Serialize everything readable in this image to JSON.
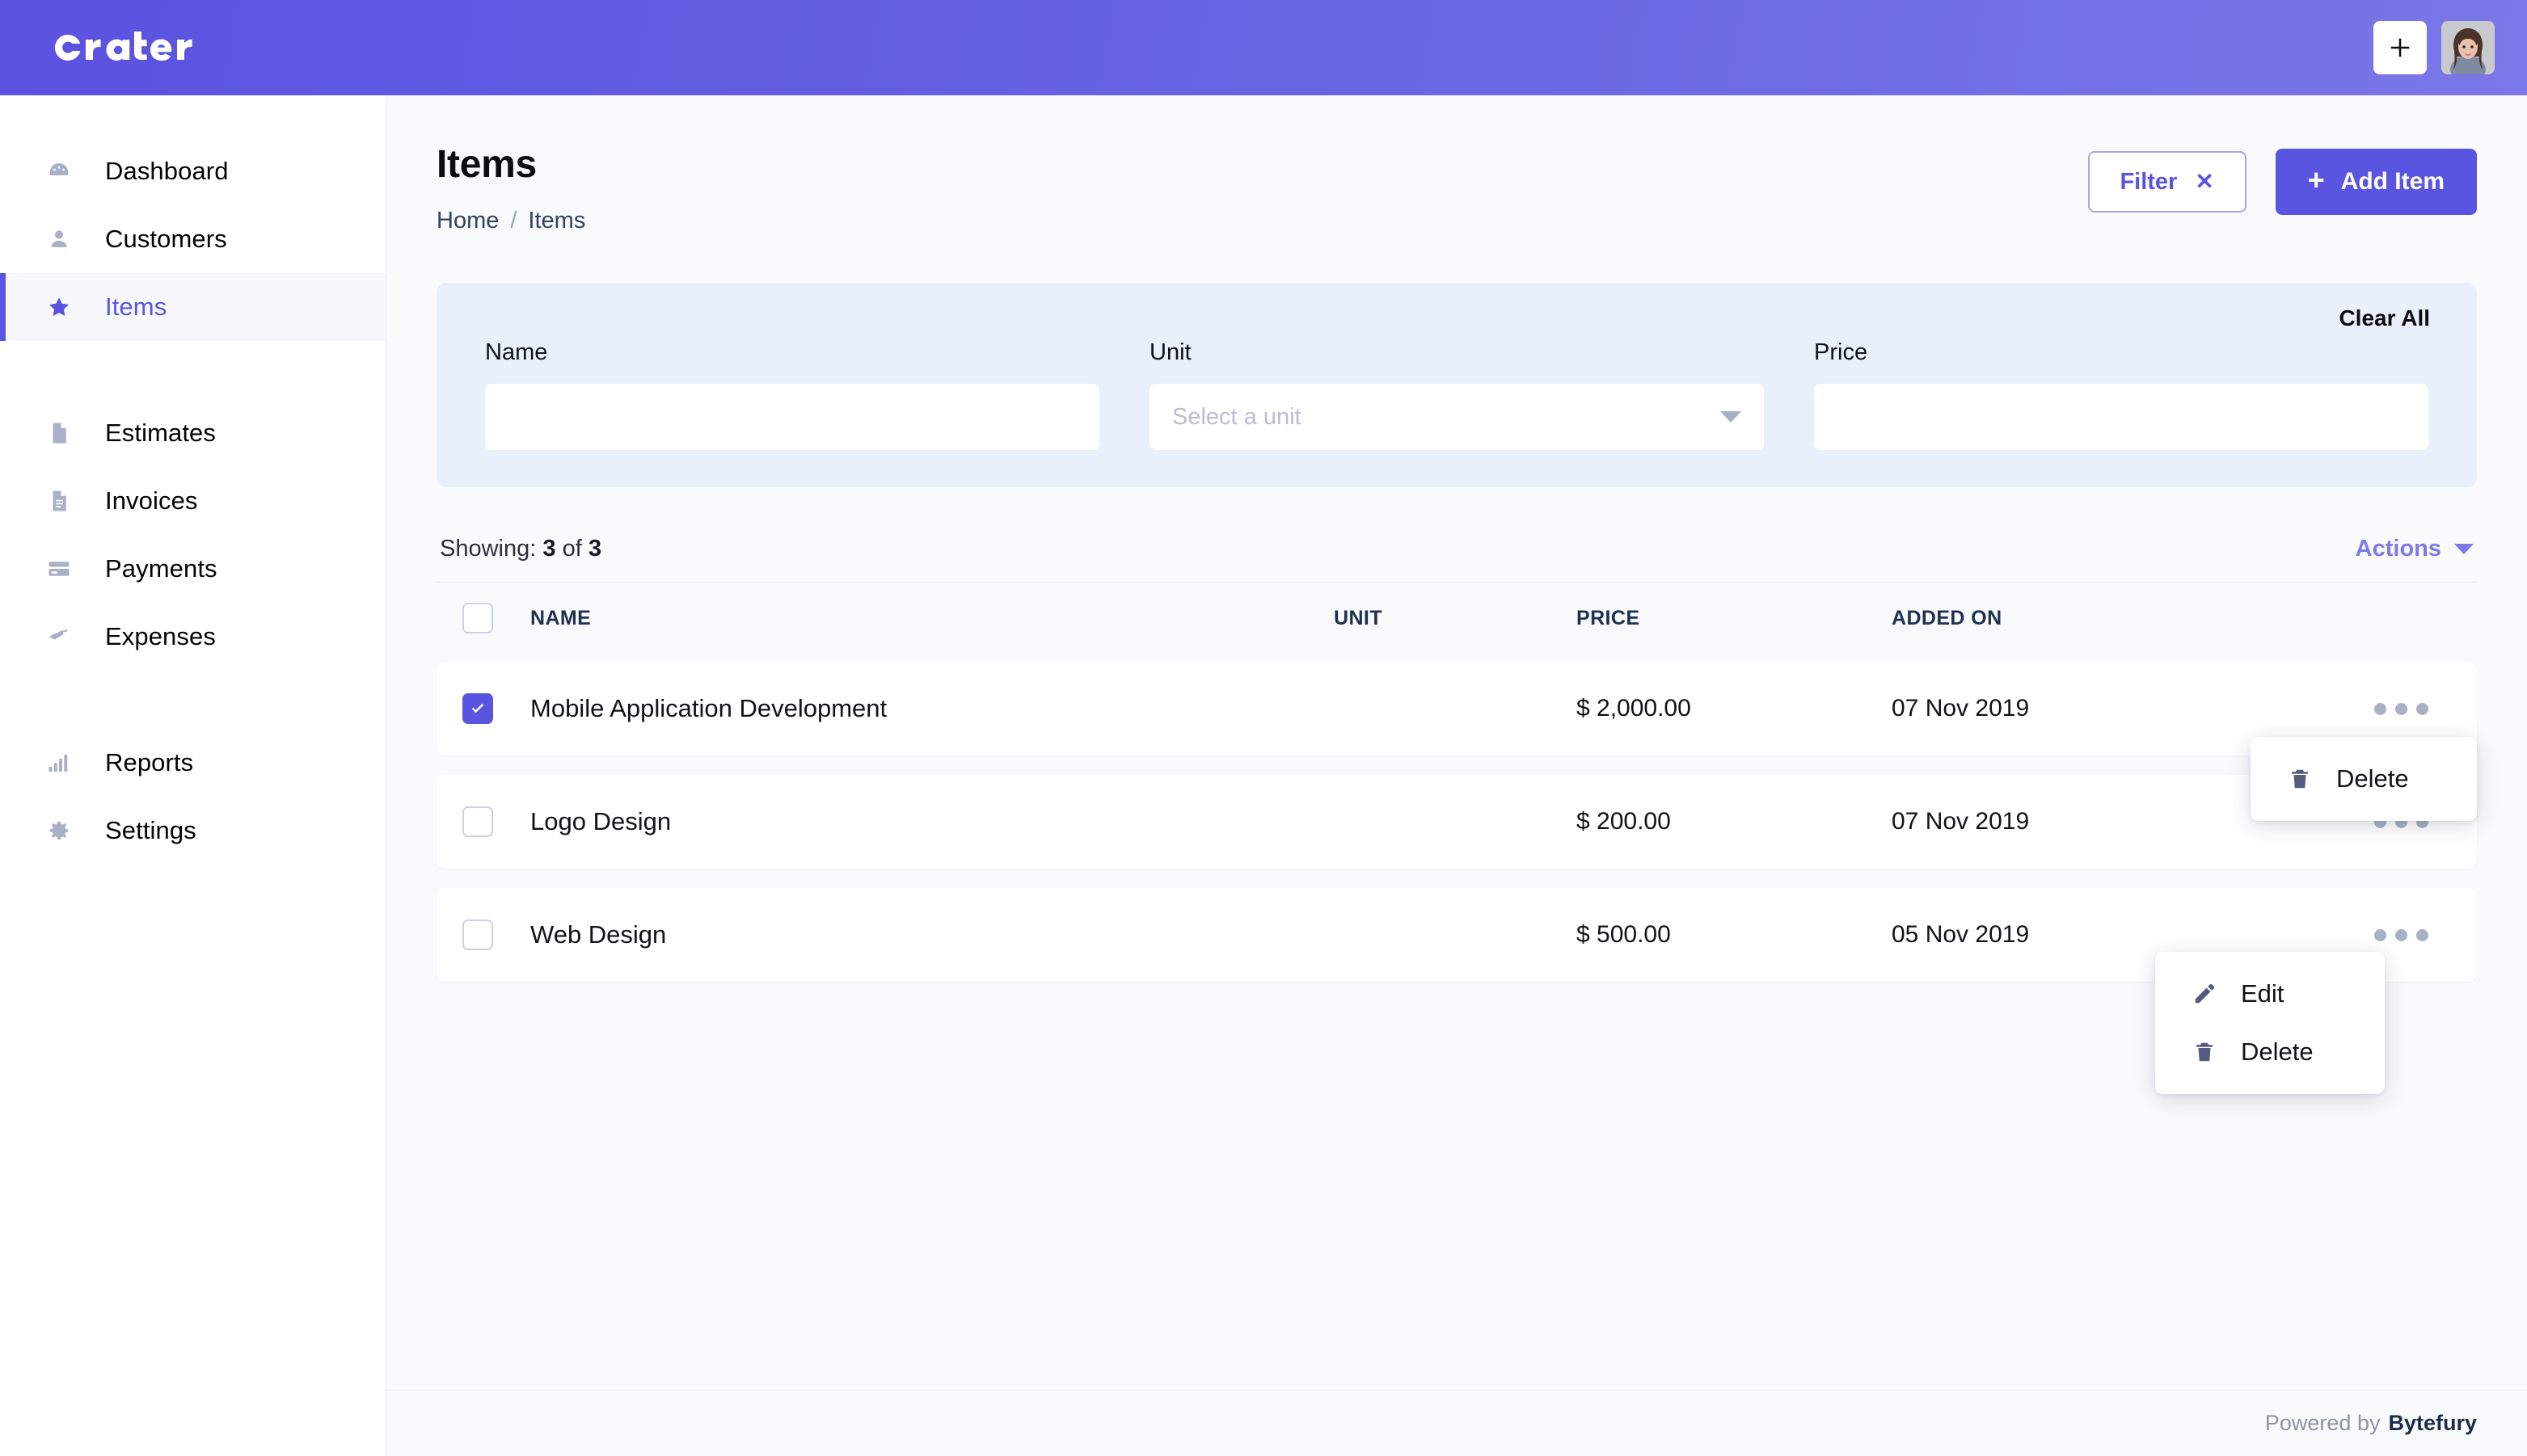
{
  "topbar": {
    "logo_text": "crater",
    "add_button_label": "+",
    "add_button_name": "plus-icon",
    "avatar_label": "user-avatar",
    "brand_color": "#5a55e0"
  },
  "sidebar": {
    "groups": [
      {
        "items": [
          {
            "label": "Dashboard",
            "icon": "dashboard-icon",
            "active": false
          },
          {
            "label": "Customers",
            "icon": "user-icon",
            "active": false
          },
          {
            "label": "Items",
            "icon": "star-icon",
            "active": true
          }
        ]
      },
      {
        "items": [
          {
            "label": "Estimates",
            "icon": "document-icon",
            "active": false
          },
          {
            "label": "Invoices",
            "icon": "invoice-icon",
            "active": false
          },
          {
            "label": "Payments",
            "icon": "credit-card-icon",
            "active": false
          },
          {
            "label": "Expenses",
            "icon": "rocket-icon",
            "active": false
          }
        ]
      },
      {
        "items": [
          {
            "label": "Reports",
            "icon": "bar-chart-icon",
            "active": false
          },
          {
            "label": "Settings",
            "icon": "gear-icon",
            "active": false
          }
        ]
      }
    ]
  },
  "page": {
    "title": "Items",
    "breadcrumb": {
      "home": "Home",
      "separator": "/",
      "current": "Items"
    },
    "filter_button": {
      "label": "Filter",
      "close_glyph": "✕"
    },
    "add_button": {
      "label": "Add Item",
      "plus_glyph": "+"
    }
  },
  "filters": {
    "clear_all": "Clear All",
    "name": {
      "label": "Name",
      "value": "",
      "placeholder": ""
    },
    "unit": {
      "label": "Unit",
      "value": "",
      "placeholder": "Select a unit"
    },
    "price": {
      "label": "Price",
      "value": "",
      "placeholder": ""
    }
  },
  "list_meta": {
    "showing_prefix": "Showing:",
    "showing_count": "3",
    "showing_of": "of",
    "showing_total": "3",
    "actions_label": "Actions"
  },
  "actions_menu": {
    "items": [
      {
        "label": "Delete",
        "icon": "trash-icon"
      }
    ]
  },
  "row_menu": {
    "items": [
      {
        "label": "Edit",
        "icon": "pencil-icon"
      },
      {
        "label": "Delete",
        "icon": "trash-icon"
      }
    ]
  },
  "table": {
    "columns": [
      "NAME",
      "UNIT",
      "PRICE",
      "ADDED ON"
    ],
    "rows": [
      {
        "name": "Mobile Application Development",
        "unit": "",
        "price": "$ 2,000.00",
        "added_on": "07 Nov 2019",
        "checked": true
      },
      {
        "name": "Logo Design",
        "unit": "",
        "price": "$ 200.00",
        "added_on": "07 Nov 2019",
        "checked": false
      },
      {
        "name": "Web Design",
        "unit": "",
        "price": "$ 500.00",
        "added_on": "05 Nov 2019",
        "checked": false
      }
    ]
  },
  "footer": {
    "prefix": "Powered by",
    "brand": "Bytefury"
  }
}
